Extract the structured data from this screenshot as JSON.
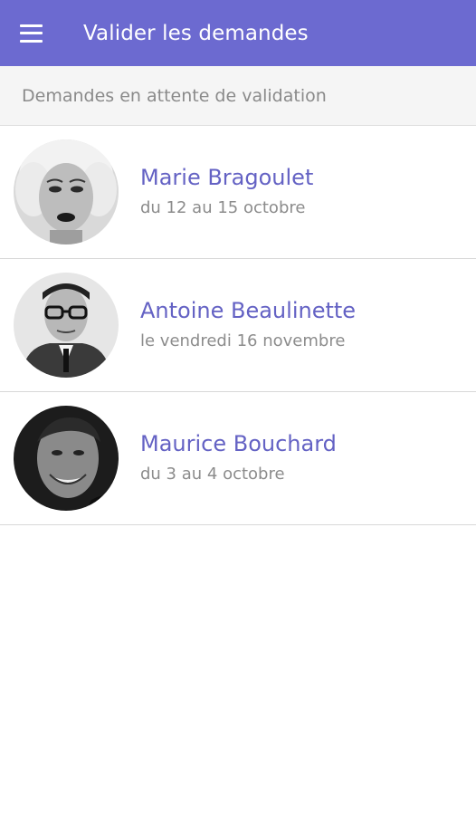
{
  "appbar": {
    "title": "Valider les demandes",
    "menu_icon": "hamburger-menu-icon",
    "background": "#6c6ad0"
  },
  "section": {
    "header": "Demandes en attente de validation"
  },
  "requests": [
    {
      "name": "Marie Bragoulet",
      "dates": "du 12 au 15 octobre"
    },
    {
      "name": "Antoine Beaulinette",
      "dates": "le vendredi 16 novembre"
    },
    {
      "name": "Maurice Bouchard",
      "dates": "du 3 au 4 octobre"
    }
  ],
  "colors": {
    "accent": "#6c6ad0",
    "name_text": "#6462c4",
    "secondary_text": "#8c8c8c"
  }
}
